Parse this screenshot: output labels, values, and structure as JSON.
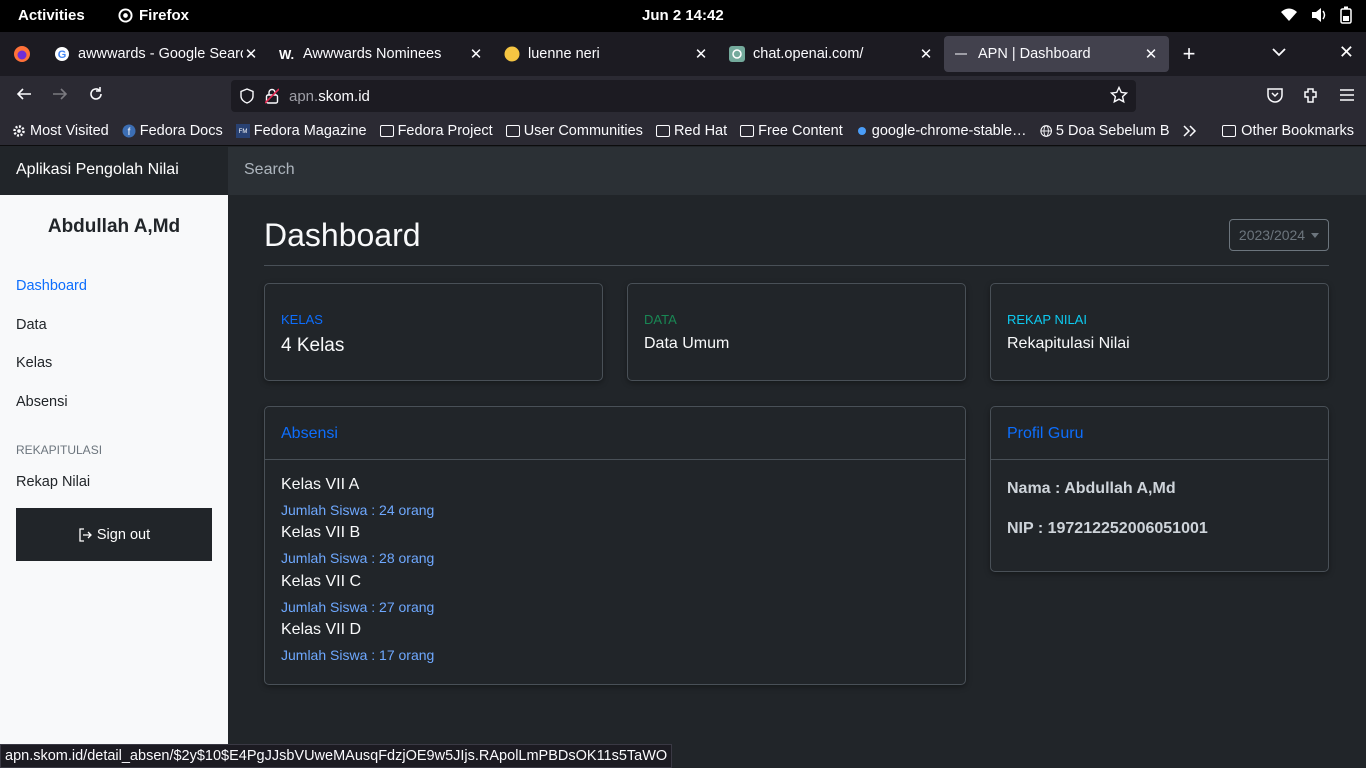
{
  "system": {
    "activities": "Activities",
    "app_name": "Firefox",
    "clock": "Jun 2  14:42"
  },
  "tabs": [
    {
      "title": "awwwards - Google Search",
      "icon": "google-icon"
    },
    {
      "title": "Awwwards Nominees",
      "icon": "awwwards-icon"
    },
    {
      "title": "luenne neri",
      "icon": "yellow-circle-icon"
    },
    {
      "title": "chat.openai.com/",
      "icon": "openai-icon"
    },
    {
      "title": "APN | Dashboard",
      "icon": "site-icon",
      "active": true
    }
  ],
  "urlbar": {
    "host_prefix": "apn.",
    "host_domain": "skom.id"
  },
  "bookmarks": [
    {
      "label": "Most Visited",
      "icon": "gear-icon"
    },
    {
      "label": "Fedora Docs",
      "icon": "fedora-icon"
    },
    {
      "label": "Fedora Magazine",
      "icon": "fm-icon"
    },
    {
      "label": "Fedora Project",
      "icon": "folder-icon"
    },
    {
      "label": "User Communities",
      "icon": "folder-icon"
    },
    {
      "label": "Red Hat",
      "icon": "folder-icon"
    },
    {
      "label": "Free Content",
      "icon": "folder-icon"
    },
    {
      "label": "google-chrome-stable…",
      "icon": "dot-icon"
    },
    {
      "label": "5 Doa Sebelum B",
      "icon": "globe-icon"
    }
  ],
  "other_bookmarks": "Other Bookmarks",
  "app": {
    "brand": "Aplikasi Pengolah Nilai",
    "search_placeholder": "Search",
    "user_name": "Abdullah A,Md",
    "nav": {
      "dashboard": "Dashboard",
      "data": "Data",
      "kelas": "Kelas",
      "absensi": "Absensi",
      "heading": "REKAPITULASI",
      "rekap": "Rekap Nilai"
    },
    "signout": "Sign out"
  },
  "dashboard": {
    "title": "Dashboard",
    "year": "2023/2024",
    "cards": {
      "kelas": {
        "label": "KELAS",
        "value": "4 Kelas",
        "color": "#0d6efd"
      },
      "data": {
        "label": "DATA",
        "value": "Data Umum",
        "color": "#198754"
      },
      "rekap": {
        "label": "REKAP NILAI",
        "value": "Rekapitulasi Nilai",
        "color": "#0dcaf0"
      }
    },
    "absensi": {
      "header": "Absensi",
      "items": [
        {
          "name": "Kelas VII A",
          "count": "Jumlah Siswa : 24 orang"
        },
        {
          "name": "Kelas VII B",
          "count": "Jumlah Siswa : 28 orang"
        },
        {
          "name": "Kelas VII C",
          "count": "Jumlah Siswa : 27 orang"
        },
        {
          "name": "Kelas VII D",
          "count": "Jumlah Siswa : 17 orang"
        }
      ]
    },
    "profil": {
      "header": "Profil Guru",
      "nama": "Nama : Abdullah A,Md",
      "nip": "NIP : 197212252006051001"
    }
  },
  "status_url": "apn.skom.id/detail_absen/$2y$10$E4PgJJsbVUweMAusqFdzjOE9w5JIjs.RApolLmPBDsOK11s5TaWO"
}
